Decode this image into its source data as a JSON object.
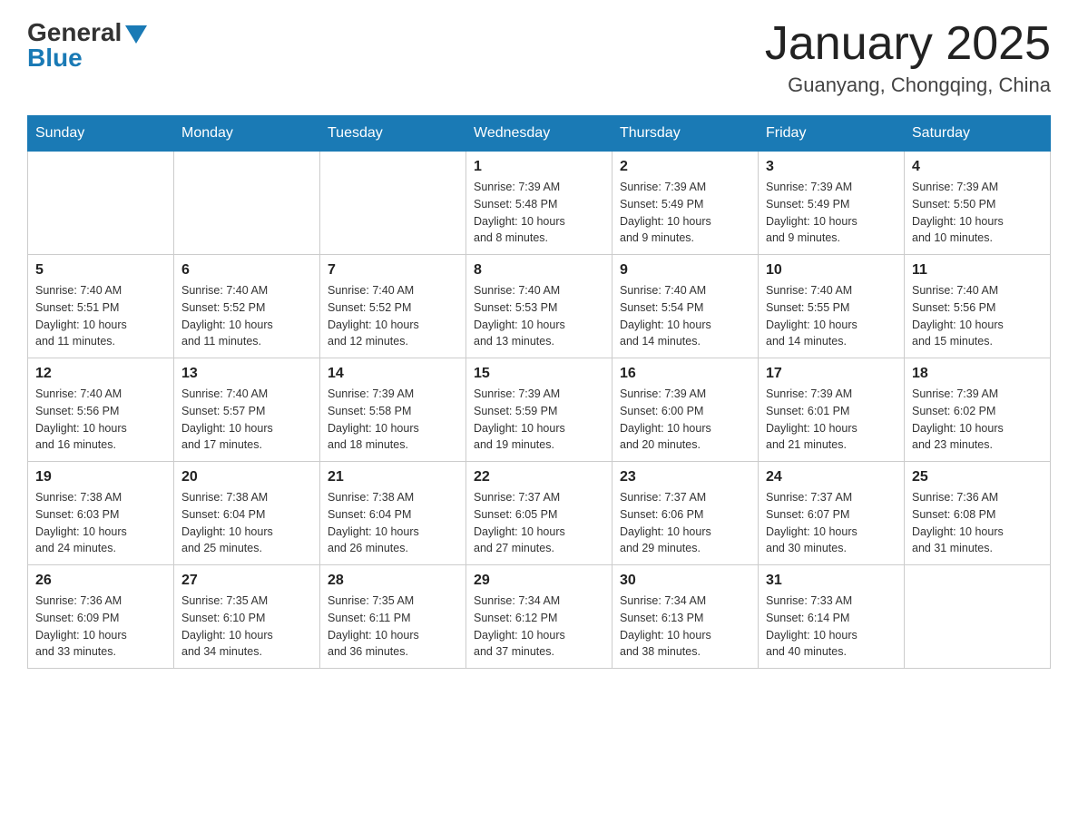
{
  "header": {
    "logo_general": "General",
    "logo_blue": "Blue",
    "title": "January 2025",
    "location": "Guanyang, Chongqing, China"
  },
  "days_of_week": [
    "Sunday",
    "Monday",
    "Tuesday",
    "Wednesday",
    "Thursday",
    "Friday",
    "Saturday"
  ],
  "weeks": [
    [
      {
        "day": "",
        "info": ""
      },
      {
        "day": "",
        "info": ""
      },
      {
        "day": "",
        "info": ""
      },
      {
        "day": "1",
        "info": "Sunrise: 7:39 AM\nSunset: 5:48 PM\nDaylight: 10 hours\nand 8 minutes."
      },
      {
        "day": "2",
        "info": "Sunrise: 7:39 AM\nSunset: 5:49 PM\nDaylight: 10 hours\nand 9 minutes."
      },
      {
        "day": "3",
        "info": "Sunrise: 7:39 AM\nSunset: 5:49 PM\nDaylight: 10 hours\nand 9 minutes."
      },
      {
        "day": "4",
        "info": "Sunrise: 7:39 AM\nSunset: 5:50 PM\nDaylight: 10 hours\nand 10 minutes."
      }
    ],
    [
      {
        "day": "5",
        "info": "Sunrise: 7:40 AM\nSunset: 5:51 PM\nDaylight: 10 hours\nand 11 minutes."
      },
      {
        "day": "6",
        "info": "Sunrise: 7:40 AM\nSunset: 5:52 PM\nDaylight: 10 hours\nand 11 minutes."
      },
      {
        "day": "7",
        "info": "Sunrise: 7:40 AM\nSunset: 5:52 PM\nDaylight: 10 hours\nand 12 minutes."
      },
      {
        "day": "8",
        "info": "Sunrise: 7:40 AM\nSunset: 5:53 PM\nDaylight: 10 hours\nand 13 minutes."
      },
      {
        "day": "9",
        "info": "Sunrise: 7:40 AM\nSunset: 5:54 PM\nDaylight: 10 hours\nand 14 minutes."
      },
      {
        "day": "10",
        "info": "Sunrise: 7:40 AM\nSunset: 5:55 PM\nDaylight: 10 hours\nand 14 minutes."
      },
      {
        "day": "11",
        "info": "Sunrise: 7:40 AM\nSunset: 5:56 PM\nDaylight: 10 hours\nand 15 minutes."
      }
    ],
    [
      {
        "day": "12",
        "info": "Sunrise: 7:40 AM\nSunset: 5:56 PM\nDaylight: 10 hours\nand 16 minutes."
      },
      {
        "day": "13",
        "info": "Sunrise: 7:40 AM\nSunset: 5:57 PM\nDaylight: 10 hours\nand 17 minutes."
      },
      {
        "day": "14",
        "info": "Sunrise: 7:39 AM\nSunset: 5:58 PM\nDaylight: 10 hours\nand 18 minutes."
      },
      {
        "day": "15",
        "info": "Sunrise: 7:39 AM\nSunset: 5:59 PM\nDaylight: 10 hours\nand 19 minutes."
      },
      {
        "day": "16",
        "info": "Sunrise: 7:39 AM\nSunset: 6:00 PM\nDaylight: 10 hours\nand 20 minutes."
      },
      {
        "day": "17",
        "info": "Sunrise: 7:39 AM\nSunset: 6:01 PM\nDaylight: 10 hours\nand 21 minutes."
      },
      {
        "day": "18",
        "info": "Sunrise: 7:39 AM\nSunset: 6:02 PM\nDaylight: 10 hours\nand 23 minutes."
      }
    ],
    [
      {
        "day": "19",
        "info": "Sunrise: 7:38 AM\nSunset: 6:03 PM\nDaylight: 10 hours\nand 24 minutes."
      },
      {
        "day": "20",
        "info": "Sunrise: 7:38 AM\nSunset: 6:04 PM\nDaylight: 10 hours\nand 25 minutes."
      },
      {
        "day": "21",
        "info": "Sunrise: 7:38 AM\nSunset: 6:04 PM\nDaylight: 10 hours\nand 26 minutes."
      },
      {
        "day": "22",
        "info": "Sunrise: 7:37 AM\nSunset: 6:05 PM\nDaylight: 10 hours\nand 27 minutes."
      },
      {
        "day": "23",
        "info": "Sunrise: 7:37 AM\nSunset: 6:06 PM\nDaylight: 10 hours\nand 29 minutes."
      },
      {
        "day": "24",
        "info": "Sunrise: 7:37 AM\nSunset: 6:07 PM\nDaylight: 10 hours\nand 30 minutes."
      },
      {
        "day": "25",
        "info": "Sunrise: 7:36 AM\nSunset: 6:08 PM\nDaylight: 10 hours\nand 31 minutes."
      }
    ],
    [
      {
        "day": "26",
        "info": "Sunrise: 7:36 AM\nSunset: 6:09 PM\nDaylight: 10 hours\nand 33 minutes."
      },
      {
        "day": "27",
        "info": "Sunrise: 7:35 AM\nSunset: 6:10 PM\nDaylight: 10 hours\nand 34 minutes."
      },
      {
        "day": "28",
        "info": "Sunrise: 7:35 AM\nSunset: 6:11 PM\nDaylight: 10 hours\nand 36 minutes."
      },
      {
        "day": "29",
        "info": "Sunrise: 7:34 AM\nSunset: 6:12 PM\nDaylight: 10 hours\nand 37 minutes."
      },
      {
        "day": "30",
        "info": "Sunrise: 7:34 AM\nSunset: 6:13 PM\nDaylight: 10 hours\nand 38 minutes."
      },
      {
        "day": "31",
        "info": "Sunrise: 7:33 AM\nSunset: 6:14 PM\nDaylight: 10 hours\nand 40 minutes."
      },
      {
        "day": "",
        "info": ""
      }
    ]
  ]
}
